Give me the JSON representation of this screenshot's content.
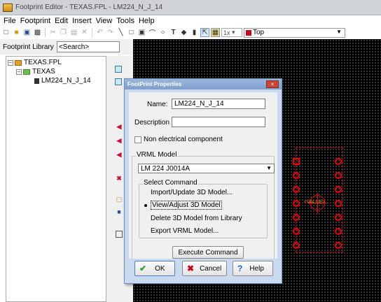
{
  "window": {
    "title": "Footprint Editor - TEXAS.FPL - LM224_N_J_14"
  },
  "menu": [
    "File",
    "Footprint",
    "Edit",
    "Insert",
    "View",
    "Tools",
    "Help"
  ],
  "toolbar": {
    "zoom": "1x",
    "layer": "Top",
    "layer_color": "#d0021b"
  },
  "library": {
    "label": "Footprint Library",
    "search_value": "<Search>"
  },
  "tree": {
    "root": "TEXAS.FPL",
    "group": "TEXAS",
    "item": "LM224_N_J_14"
  },
  "canvas": {
    "value_label": "<VALUE>",
    "pad_color": "#ee0000",
    "outline_color": "#cc0000"
  },
  "dialog": {
    "title": "FootPrint Properties",
    "close_label": "×",
    "name_label": "Name:",
    "name_value": "LM224_N_J_14",
    "description_label": "Description",
    "description_value": "",
    "non_electrical_label": "Non electrical component",
    "vrml_group": "VRML Model",
    "vrml_value": "LM 224 J0014A",
    "select_command_label": "Select Command",
    "commands": [
      "Import/Update 3D Model...",
      "View/Adjust 3D Model",
      "Delete 3D Model from Library",
      "Export VRML Model..."
    ],
    "selected_command": "View/Adjust 3D Model",
    "execute_label": "Execute Command",
    "ok_label": "OK",
    "cancel_label": "Cancel",
    "help_label": "Help"
  }
}
